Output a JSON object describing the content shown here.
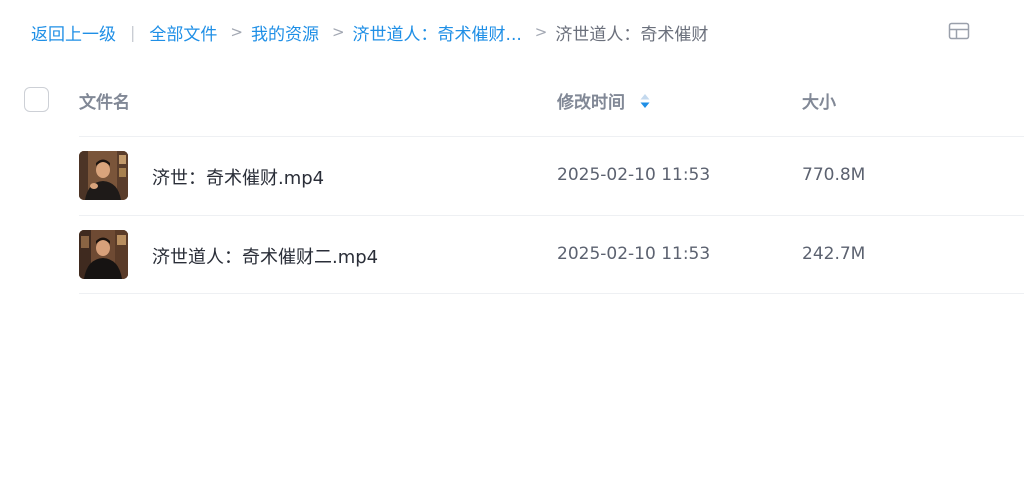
{
  "breadcrumb": {
    "back": "返回上一级",
    "items": [
      "全部文件",
      "我的资源",
      "济世道人：奇术催财..."
    ],
    "current": "济世道人：奇术催财"
  },
  "table": {
    "columns": {
      "name": "文件名",
      "time": "修改时间",
      "size": "大小"
    },
    "rows": [
      {
        "name": "济世：奇术催财.mp4",
        "time": "2025-02-10 11:53",
        "size": "770.8M"
      },
      {
        "name": "济世道人：奇术催财二.mp4",
        "time": "2025-02-10 11:53",
        "size": "242.7M"
      }
    ]
  },
  "icons": {
    "layout": "table-layout-icon",
    "sort": "sort-icon",
    "thumbnail": "video-thumbnail"
  },
  "colors": {
    "accent": "#1f8fe6",
    "text": "#2a2e38",
    "muted": "#818896",
    "divider": "#eef0f3"
  }
}
